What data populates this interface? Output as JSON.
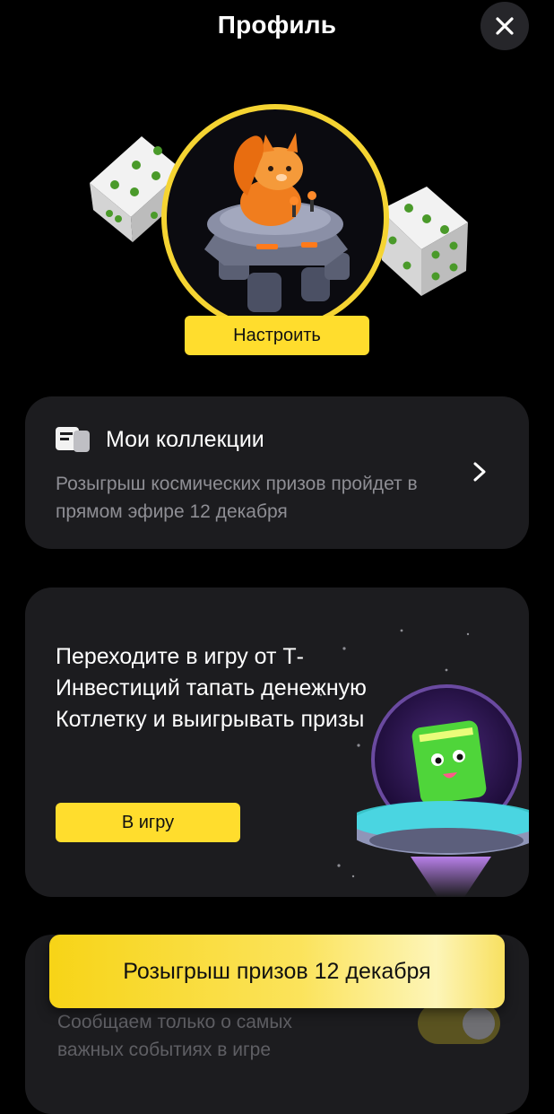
{
  "header": {
    "title": "Профиль"
  },
  "avatar": {
    "setup_label": "Настроить"
  },
  "collections": {
    "title": "Мои коллекции",
    "description": "Розыгрыш космических призов пройдет в прямом эфире 12 декабря"
  },
  "game_promo": {
    "text": "Переходите в игру от Т-Инвестиций тапать денежную Котлетку и выигрывать призы",
    "button_label": "В игру"
  },
  "prize_banner": {
    "label": "Розыгрыш призов 12 декабря"
  },
  "notifications": {
    "description": "Сообщаем только о самых важных событиях в игре",
    "toggle_on": true
  },
  "colors": {
    "accent": "#ffdd2d",
    "card": "#1c1c1f",
    "background": "#000000",
    "muted_text": "#8e8e94"
  }
}
